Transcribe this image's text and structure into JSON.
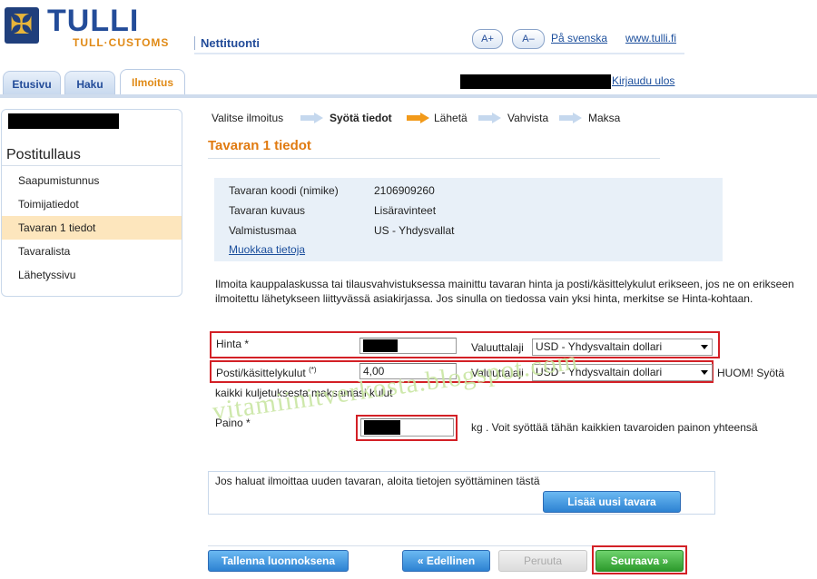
{
  "header": {
    "brand": "TULLI",
    "brand_sub": "TULL·CUSTOMS",
    "app_name": "Nettituonti",
    "font_larger": "A+",
    "font_smaller": "A–",
    "swedish_link": "På svenska",
    "site_link": "www.tulli.fi",
    "logout": "Kirjaudu ulos"
  },
  "tabs": [
    {
      "label": "Etusivu"
    },
    {
      "label": "Haku"
    },
    {
      "label": "Ilmoitus"
    }
  ],
  "sidebar": {
    "title": "Postitullaus",
    "items": [
      {
        "label": "Saapumistunnus"
      },
      {
        "label": "Toimijatiedot"
      },
      {
        "label": "Tavaran 1 tiedot"
      },
      {
        "label": "Tavaralista"
      },
      {
        "label": "Lähetyssivu"
      }
    ]
  },
  "steps": [
    {
      "label": "Valitse ilmoitus"
    },
    {
      "label": "Syötä tiedot"
    },
    {
      "label": "Lähetä"
    },
    {
      "label": "Vahvista"
    },
    {
      "label": "Maksa"
    }
  ],
  "section_title": "Tavaran 1 tiedot",
  "info": {
    "code_label": "Tavaran koodi (nimike)",
    "code_value": "2106909260",
    "desc_label": "Tavaran kuvaus",
    "desc_value": "Lisäravinteet",
    "origin_label": "Valmistusmaa",
    "origin_value": "US - Yhdysvallat",
    "edit_link": "Muokkaa tietoja"
  },
  "note": "Ilmoita kauppalaskussa tai tilausvahvistuksessa mainittu tavaran hinta ja posti/käsittelykulut erikseen, jos ne on erikseen ilmoitettu lähetykseen liittyvässä asiakirjassa. Jos sinulla on tiedossa vain yksi hinta, merkitse se Hinta-kohtaan.",
  "form": {
    "price_label": "Hinta *",
    "currency_label": "Valuuttalaji",
    "price_currency": "USD - Yhdysvaltain dollari",
    "postage_label": "Posti/käsittelykulut",
    "postage_sup": "(*)",
    "postage_value": "4,00",
    "postage_currency": "USD - Yhdysvaltain dollari",
    "postage_note_a": "HUOM! Syötä",
    "postage_note_b": "kaikki kuljetuksesta maksamasi kulut",
    "weight_label": "Paino *",
    "weight_note": "kg . Voit syöttää tähän kaikkien tavaroiden painon yhteensä"
  },
  "new_item": {
    "text": "Jos haluat ilmoittaa uuden tavaran, aloita tietojen syöttäminen tästä",
    "button": "Lisää uusi tavara"
  },
  "buttons": {
    "save_draft": "Tallenna luonnoksena",
    "previous": "« Edellinen",
    "cancel": "Peruuta",
    "next": "Seuraava »"
  },
  "watermark": "vitamiinitverkosta.blogspot.com",
  "colors": {
    "brand_blue": "#234c99",
    "accent_orange": "#e08a16",
    "highlight_red": "#d32026",
    "button_blue": "#2d82d2",
    "button_green": "#2c9a2c"
  },
  "icons": {
    "logo": "crossed-keys-crown-icon",
    "arrow": "step-arrow-icon"
  }
}
